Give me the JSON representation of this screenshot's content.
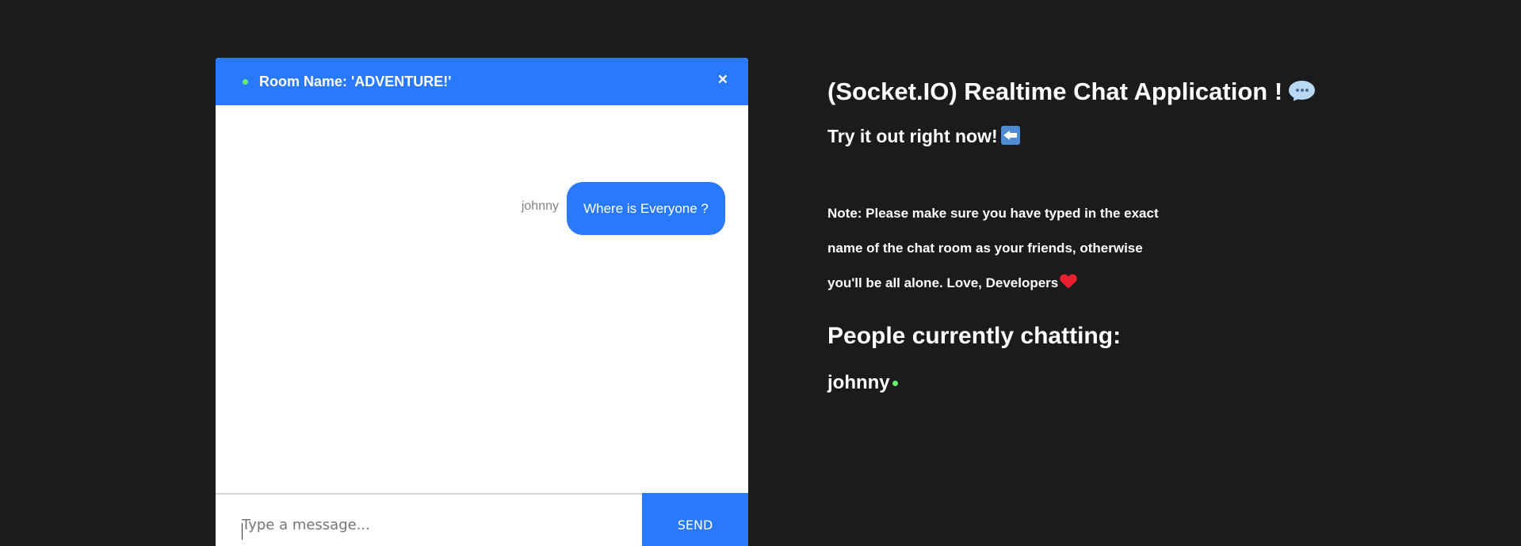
{
  "chat": {
    "room_name": "Room Name: 'ADVENTURE!'",
    "close_label": "×",
    "messages": [
      {
        "sender": "johnny",
        "text": "Where is Everyone ?"
      }
    ],
    "input_placeholder": "Type a message...",
    "send_label": "SEND"
  },
  "info": {
    "title": "(Socket.IO) Realtime Chat Application !",
    "subtitle": "Try it out right now!",
    "note_lines": [
      "Note: Please make sure you have typed in the exact",
      "name of the chat room as your friends, otherwise",
      "you'll be all alone. Love, Developers"
    ],
    "people_heading": "People currently chatting:",
    "people": [
      "johnny"
    ]
  },
  "icons": {
    "title_icon": "speech-bubble-icon",
    "subtitle_icon": "left-arrow-icon",
    "note_icon": "heart-icon",
    "status_icon": "online-dot-icon"
  },
  "colors": {
    "background": "#1b1b1d",
    "accent": "#2979ff",
    "online": "#5ff06d",
    "heart": "#e8202e"
  }
}
